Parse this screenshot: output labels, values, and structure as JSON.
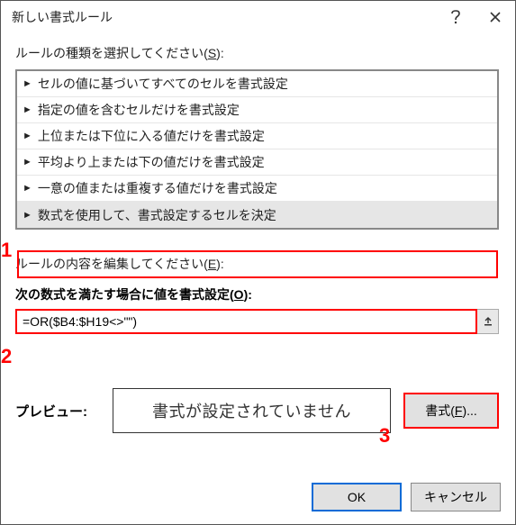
{
  "titlebar": {
    "title": "新しい書式ルール"
  },
  "sections": {
    "select_type_prefix": "ルールの種類を選択してください(",
    "select_type_key": "S",
    "select_type_suffix": "):",
    "edit_content_prefix": "ルールの内容を編集してください(",
    "edit_content_key": "E",
    "edit_content_suffix": "):"
  },
  "rule_types": [
    {
      "label": "セルの値に基づいてすべてのセルを書式設定",
      "selected": false
    },
    {
      "label": "指定の値を含むセルだけを書式設定",
      "selected": false
    },
    {
      "label": "上位または下位に入る値だけを書式設定",
      "selected": false
    },
    {
      "label": "平均より上または下の値だけを書式設定",
      "selected": false
    },
    {
      "label": "一意の値または重複する値だけを書式設定",
      "selected": false
    },
    {
      "label": "数式を使用して、書式設定するセルを決定",
      "selected": true
    }
  ],
  "formula": {
    "label_prefix": "次の数式を満たす場合に値を書式設定(",
    "label_key": "O",
    "label_suffix": "):",
    "value": "=OR($B4:$H19<>\"\")"
  },
  "preview": {
    "label": "プレビュー:",
    "value": "書式が設定されていません",
    "button_prefix": "書式(",
    "button_key": "F",
    "button_suffix": ")..."
  },
  "buttons": {
    "ok": "OK",
    "cancel": "キャンセル"
  },
  "annotations": {
    "a1": "1",
    "a2": "2",
    "a3": "3"
  }
}
